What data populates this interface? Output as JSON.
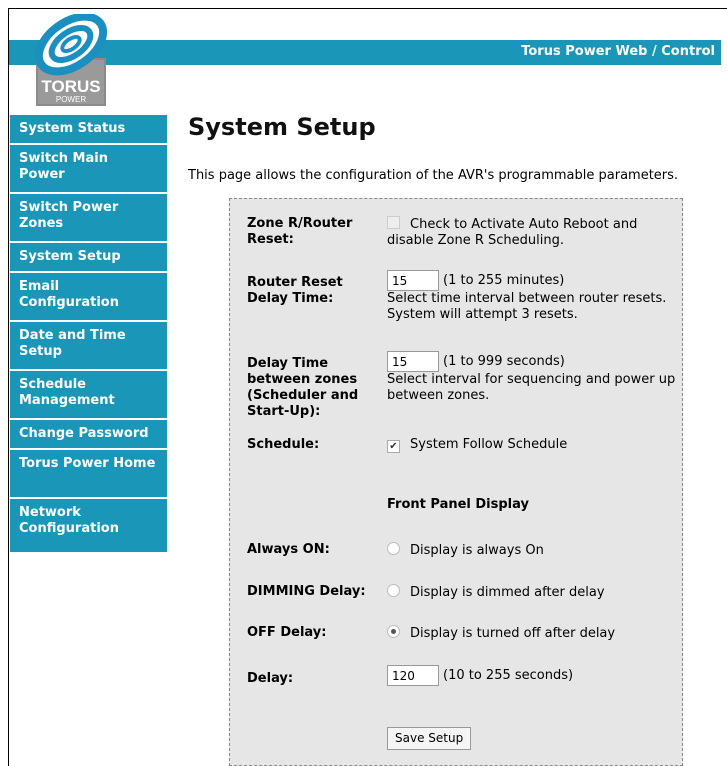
{
  "header": {
    "banner_title": "Torus Power Web / Control",
    "logo_text": "TORUS POWER"
  },
  "sidebar": {
    "items": [
      {
        "label": "System Status"
      },
      {
        "label": "Switch Main Power"
      },
      {
        "label": "Switch Power Zones"
      },
      {
        "label": "System Setup"
      },
      {
        "label": "Email Configuration"
      },
      {
        "label": "Date and Time Setup"
      },
      {
        "label": "Schedule Management"
      },
      {
        "label": "Change Password"
      },
      {
        "label": "Torus Power Home"
      },
      {
        "label": "Network Configuration"
      }
    ]
  },
  "main": {
    "title": "System Setup",
    "intro": "This page allows the configuration of the AVR's programmable parameters."
  },
  "form": {
    "zone_reset": {
      "label": "Zone R/Router Reset:",
      "checkbox_text": "Check to Activate Auto Reboot and disable Zone R Scheduling.",
      "checked": false,
      "disabled": true
    },
    "router_delay": {
      "label": "Router Reset Delay Time:",
      "value": "15",
      "range": "(1 to 255 minutes)",
      "help": "Select time interval between router resets. System will attempt 3 resets."
    },
    "zone_delay": {
      "label": "Delay Time between zones (Scheduler and Start-Up):",
      "value": "15",
      "range": "(1 to 999 seconds)",
      "help": "Select interval for sequencing and power up between zones."
    },
    "schedule": {
      "label": "Schedule:",
      "checkbox_text": "System Follow Schedule",
      "checked": true
    },
    "front_panel_title": "Front Panel Display",
    "always_on": {
      "label": "Always ON:",
      "radio_text": "Display is always On",
      "selected": false
    },
    "dimming": {
      "label": "DIMMING Delay:",
      "radio_text": "Display is dimmed after delay",
      "selected": false
    },
    "off_delay": {
      "label": "OFF Delay:",
      "radio_text": "Display is turned off after delay",
      "selected": true
    },
    "delay": {
      "label": "Delay:",
      "value": "120",
      "range": "(10 to 255 seconds)"
    },
    "save_label": "Save Setup"
  },
  "colors": {
    "accent": "#1996b8",
    "panel": "#e6e6e6"
  }
}
